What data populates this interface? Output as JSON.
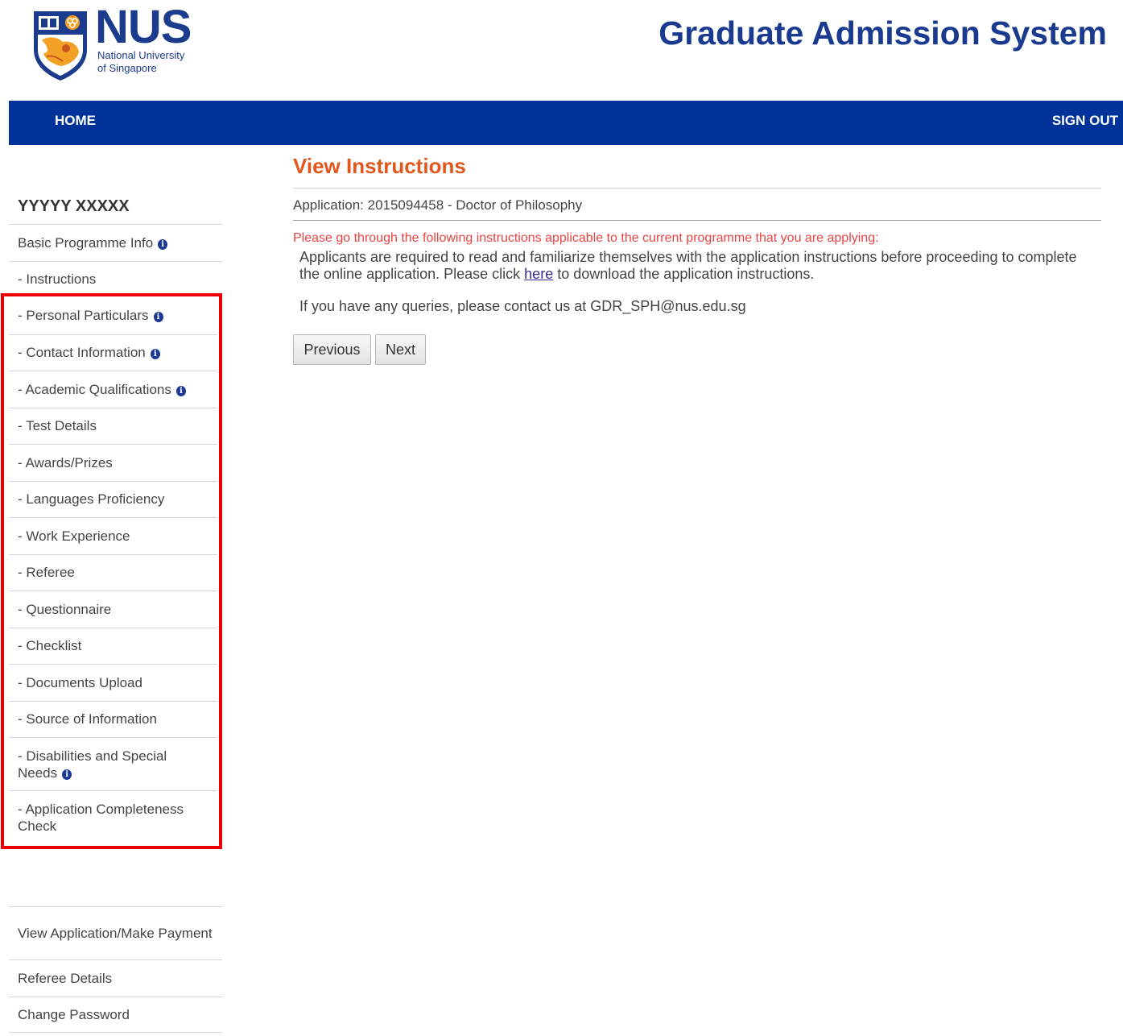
{
  "header": {
    "logo_word": "NUS",
    "logo_sub1": "National University",
    "logo_sub2": "of Singapore",
    "site_title": "Graduate Admission System"
  },
  "nav": {
    "home": "HOME",
    "sign_out": "SIGN OUT"
  },
  "sidebar": {
    "user_name": "YYYYY XXXXX",
    "top_items": [
      {
        "label": "Basic Programme Info",
        "info": true
      },
      {
        "label": "- Instructions",
        "info": false
      }
    ],
    "highlighted_items": [
      {
        "label": "- Personal Particulars",
        "info": true
      },
      {
        "label": "- Contact Information",
        "info": true
      },
      {
        "label": "- Academic Qualifications",
        "info": true
      },
      {
        "label": "- Test Details",
        "info": false
      },
      {
        "label": "- Awards/Prizes",
        "info": false
      },
      {
        "label": "- Languages Proficiency",
        "info": false
      },
      {
        "label": "- Work Experience",
        "info": false
      },
      {
        "label": "- Referee",
        "info": false
      },
      {
        "label": "- Questionnaire",
        "info": false
      },
      {
        "label": "- Checklist",
        "info": false
      },
      {
        "label": "- Documents Upload",
        "info": false
      },
      {
        "label": "- Source of Information",
        "info": false
      },
      {
        "label": "- Disabilities and Special Needs",
        "info": true
      },
      {
        "label": "- Application Completeness Check",
        "info": false
      }
    ],
    "bottom_items": [
      {
        "label": "View Application/Make Payment"
      },
      {
        "label": "Referee Details"
      },
      {
        "label": "Change Password"
      }
    ],
    "info_icon": "info-circle-icon",
    "highlight_color": "#ee0000"
  },
  "main": {
    "heading": "View Instructions",
    "application": "Application: 2015094458 - Doctor of Philosophy",
    "notice": "Please go through the following instructions applicable to the current programme that you are applying:",
    "instructions_before": "Applicants are required to read and familiarize themselves with the application instructions before proceeding to complete the online application. Please click ",
    "instructions_link": "here",
    "instructions_after": " to download the application instructions.",
    "contact": "If you have any queries, please contact us at GDR_SPH@nus.edu.sg",
    "previous_label": "Previous",
    "next_label": "Next"
  },
  "colors": {
    "nav_bg": "#003399",
    "title": "#1a3a8f",
    "heading": "#e2571b",
    "notice": "#e84545"
  }
}
